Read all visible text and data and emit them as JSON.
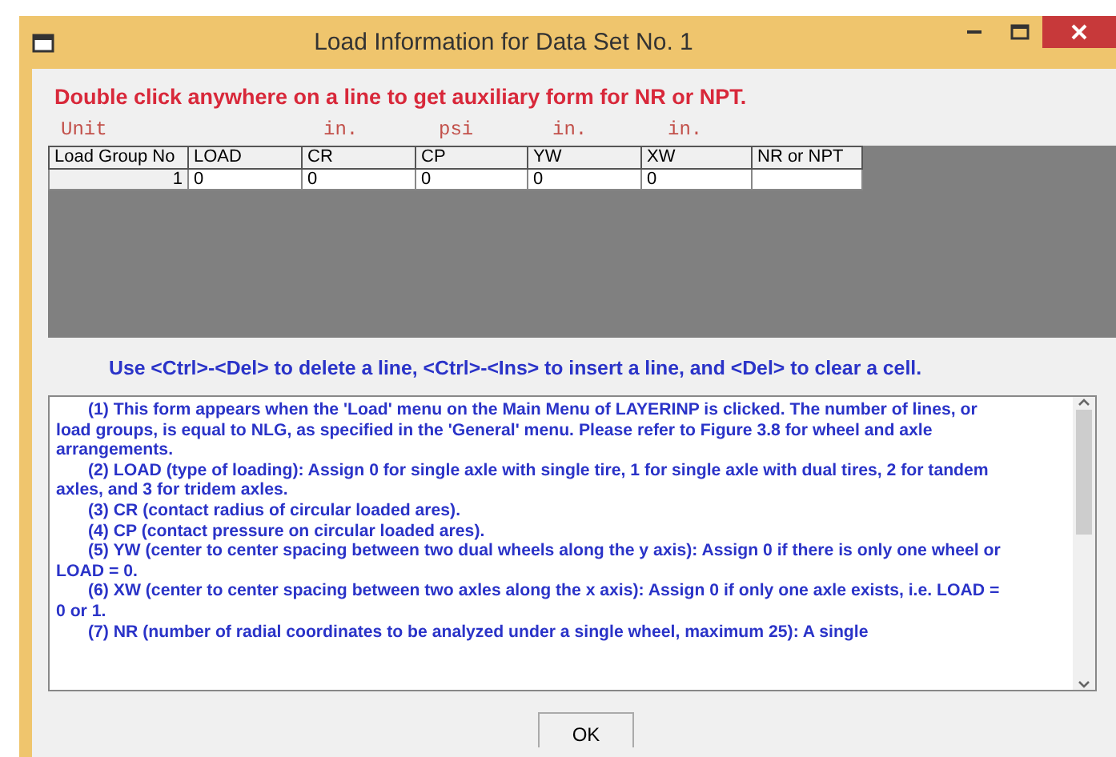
{
  "window": {
    "title": "Load Information for Data Set No. 1"
  },
  "notice": "Double click anywhere on a line to get auxiliary form for NR or NPT.",
  "unit_label": "Unit",
  "table": {
    "columns": [
      {
        "name": "Load Group No"
      },
      {
        "name": "LOAD"
      },
      {
        "name": "CR",
        "unit": "in."
      },
      {
        "name": "CP",
        "unit": "psi"
      },
      {
        "name": "YW",
        "unit": "in."
      },
      {
        "name": "XW",
        "unit": "in."
      },
      {
        "name": "NR or NPT"
      }
    ],
    "rows": [
      {
        "cells": [
          "1",
          "0",
          "0",
          "0",
          "0",
          "0"
        ]
      }
    ]
  },
  "instruction": "Use <Ctrl>-<Del> to delete a line, <Ctrl>-<Ins> to insert a line, and <Del> to clear a  cell.",
  "help": [
    "(1) This form appears when the 'Load' menu on the Main Menu of LAYERINP is clicked.  The number of lines, or load groups, is equal to NLG, as specified in the 'General' menu.  Please refer to Figure 3.8 for wheel and axle arrangements.",
    "(2) LOAD (type of loading): Assign 0 for single axle with single tire, 1 for single axle with dual tires, 2 for tandem axles, and 3 for tridem axles.",
    "(3) CR (contact radius of circular loaded ares).",
    "(4) CP (contact pressure on circular loaded ares).",
    "(5) YW (center to center spacing between two dual wheels along the y axis): Assign 0 if there is only one wheel or LOAD = 0.",
    "(6) XW (center to center spacing between two axles along the x axis): Assign 0 if only one axle exists, i.e. LOAD = 0 or 1.",
    "(7) NR (number of radial coordinates to be analyzed under a single wheel, maximum 25): A single"
  ],
  "ok_button": "OK"
}
